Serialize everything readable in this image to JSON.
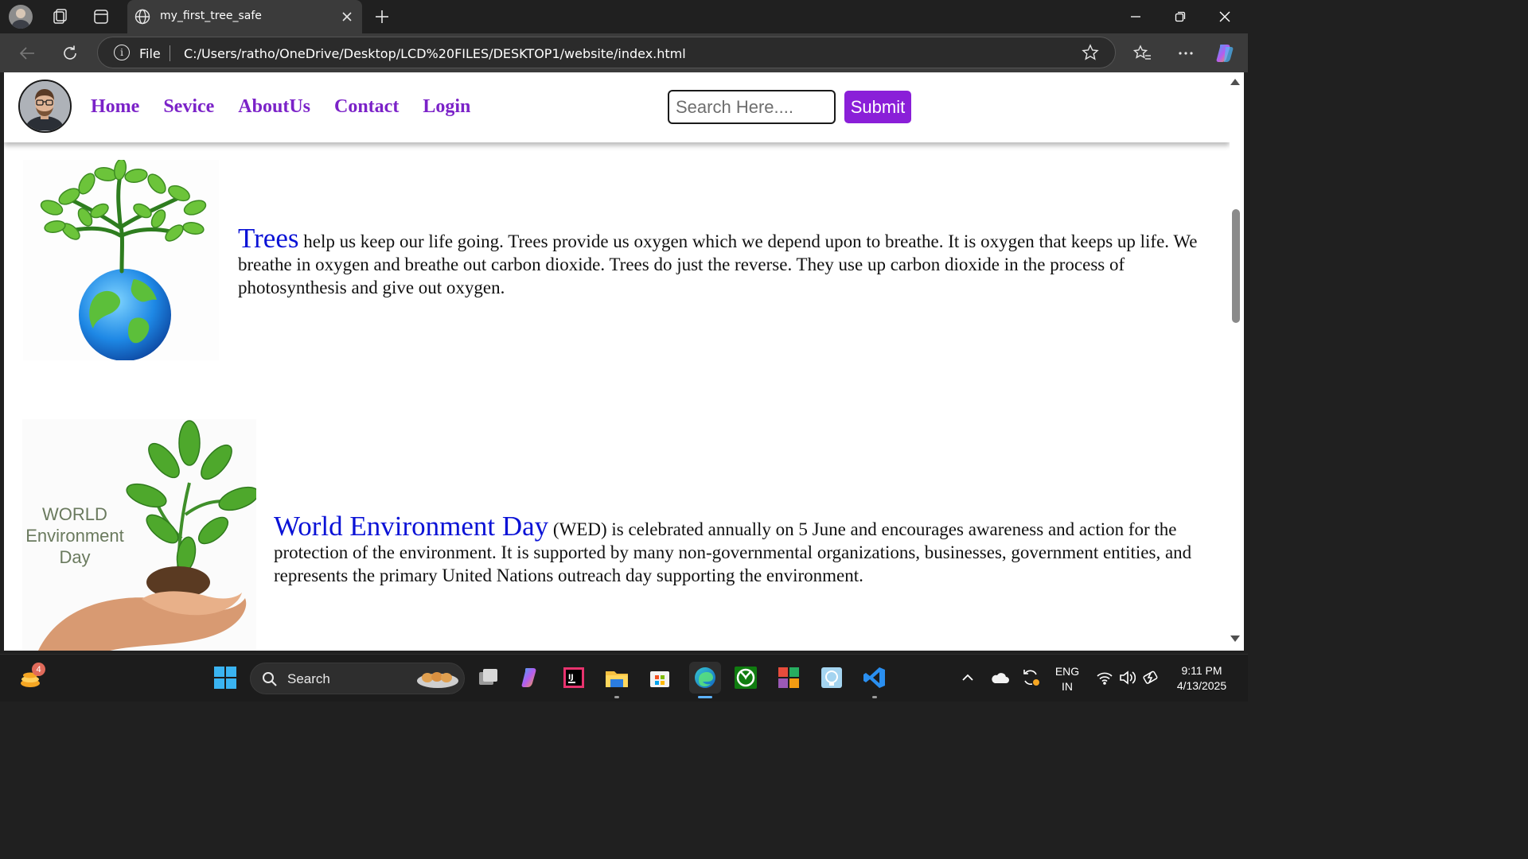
{
  "browser": {
    "tab_title": "my_first_tree_safe",
    "omnibox": {
      "scheme_label": "File",
      "url": "C:/Users/ratho/OneDrive/Desktop/LCD%20FILES/DESKTOP1/website/index.html"
    }
  },
  "site": {
    "nav": [
      "Home",
      "Sevice",
      "AboutUs",
      "Contact",
      "Login"
    ],
    "search": {
      "placeholder": "Search Here....",
      "value": ""
    },
    "submit_label": "Submit",
    "articles": [
      {
        "lead": "Trees",
        "body": " help us keep our life going. Trees provide us oxygen which we depend upon to breathe. It is oxygen that keeps up life. We breathe in oxygen and breathe out carbon dioxide. Trees do just the reverse. They use up carbon dioxide in the process of photosynthesis and give out oxygen.",
        "image_icon": "tree-globe-image"
      },
      {
        "lead": "World Environment Day",
        "body": " (WED) is celebrated annually on 5 June and encourages awareness and action for the protection of the environment. It is supported by many non-governmental organizations, businesses, government entities, and represents the primary United Nations outreach day supporting the environment.",
        "image_icon": "hands-holding-plant-image",
        "image_text": "WORLD Environment Day"
      }
    ],
    "colors": {
      "nav": "#7b22c8",
      "submit": "#8a1fd8",
      "lead": "#0a12d6"
    }
  },
  "taskbar": {
    "search_label": "Search",
    "notification_count": "4",
    "language_line1": "ENG",
    "language_line2": "IN",
    "time": "9:11 PM",
    "date": "4/13/2025"
  }
}
